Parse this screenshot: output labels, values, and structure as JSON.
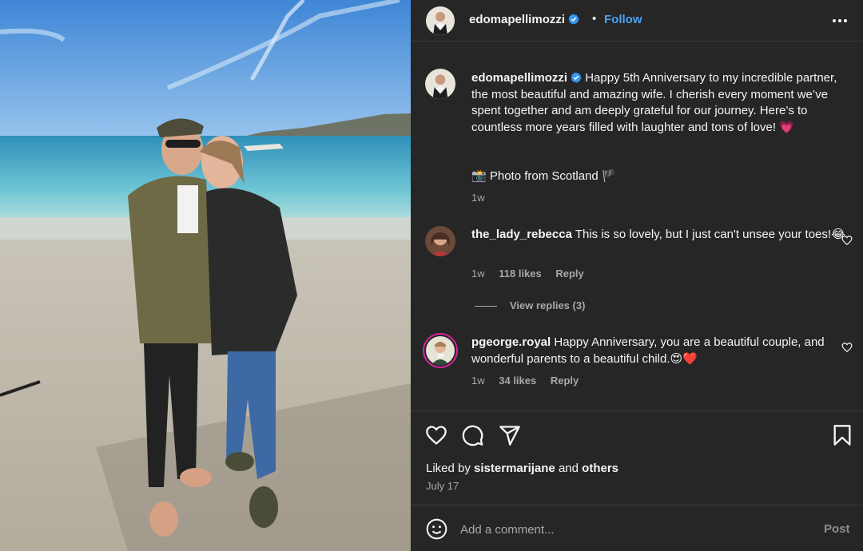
{
  "post": {
    "username": "edomapellimozzi",
    "follow_label": "Follow",
    "separator": "•"
  },
  "caption": {
    "username": "edomapellimozzi",
    "text": "Happy 5th Anniversary to my incredible partner, the most beautiful and amazing wife. I cherish every moment we’ve spent together and am deeply grateful for our journey. Here’s to countless more years filled with laughter and tons of love! 💗",
    "photo_note": "📸 Photo from Scotland 🏴",
    "time": "1w"
  },
  "comments": [
    {
      "username": "the_lady_rebecca",
      "text": "This is so lovely, but I just can't unsee your toes!😂",
      "time": "1w",
      "likes": "118 likes",
      "reply_label": "Reply",
      "view_replies": "View replies (3)"
    },
    {
      "username": "pgeorge.royal",
      "text": "Happy Anniversary, you are a beautiful couple, and wonderful parents to a beautiful child.😍❤️",
      "time": "1w",
      "likes": "34 likes",
      "reply_label": "Reply"
    }
  ],
  "engagement": {
    "liked_by_prefix": "Liked by",
    "liked_by_user": "sistermarijane",
    "and_text": "and",
    "others": "others",
    "date": "July 17"
  },
  "composer": {
    "placeholder": "Add a comment...",
    "post_label": "Post"
  },
  "icons": {
    "more": "more-options-icon",
    "verified": "verified-badge-icon",
    "like": "heart-icon",
    "comment": "comment-bubble-icon",
    "share": "paper-plane-icon",
    "save": "bookmark-icon",
    "emoji": "emoji-smiley-icon"
  },
  "colors": {
    "panel_bg": "#262626",
    "link_blue": "#4aa3f0",
    "muted_text": "#a8a8a8",
    "verified_blue": "#3797f0"
  }
}
